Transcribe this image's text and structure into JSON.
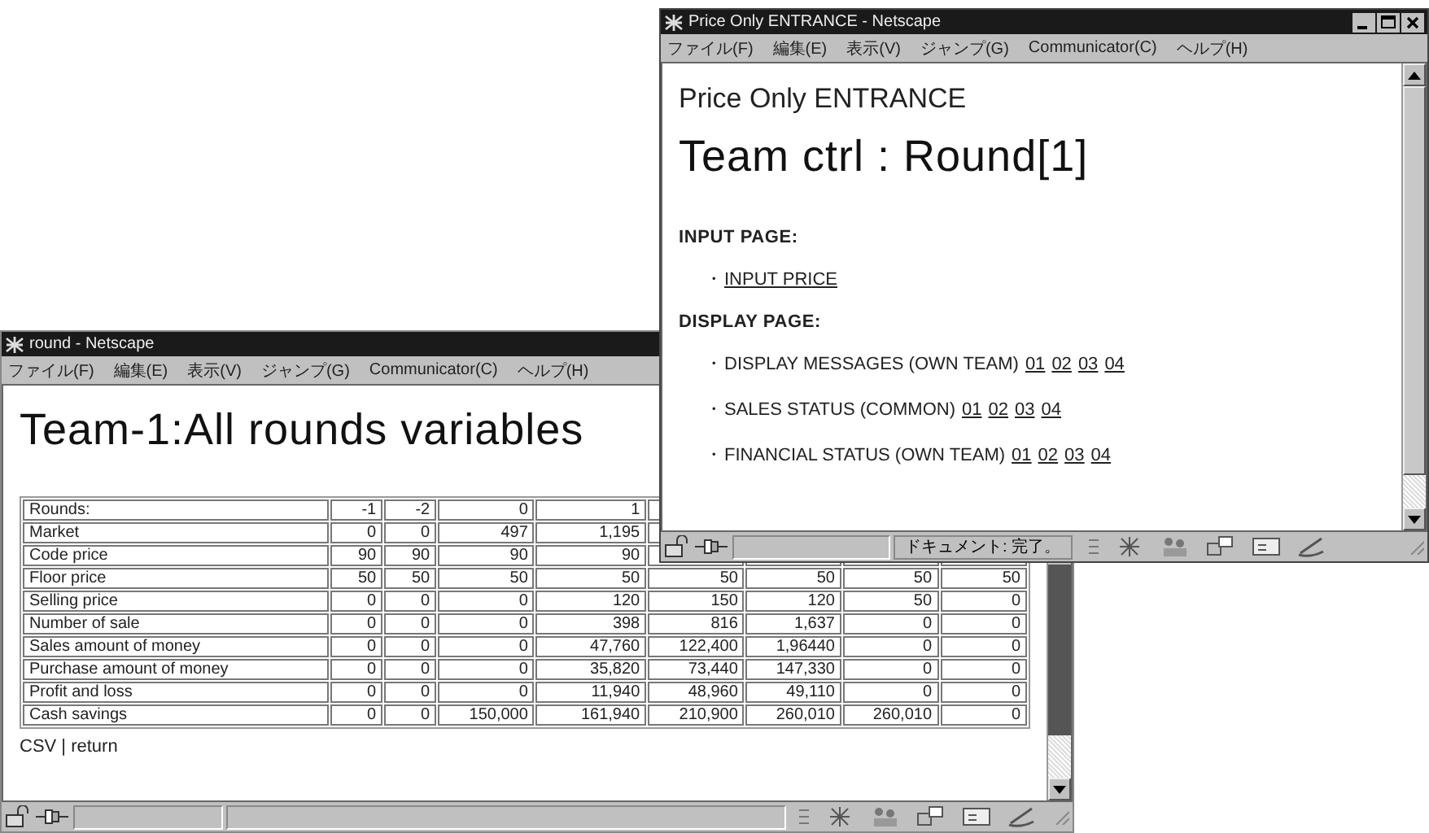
{
  "round_window": {
    "title": "round - Netscape",
    "menu": [
      "ファイル(F)",
      "編集(E)",
      "表示(V)",
      "ジャンプ(G)",
      "Communicator(C)",
      "ヘルプ(H)"
    ],
    "heading": "Team-1:All rounds variables",
    "table": {
      "columns": [
        "Rounds:",
        "-1",
        "-2",
        "0",
        "1"
      ],
      "rows": [
        {
          "label": "Market",
          "values": [
            "0",
            "0",
            "497",
            "1,195"
          ]
        },
        {
          "label": "Code price",
          "values": [
            "90",
            "90",
            "90",
            "90"
          ]
        },
        {
          "label": "Floor price",
          "values": [
            "50",
            "50",
            "50",
            "50",
            "50",
            "50",
            "50",
            "50"
          ]
        },
        {
          "label": "Selling price",
          "values": [
            "0",
            "0",
            "0",
            "120",
            "150",
            "120",
            "50",
            "0"
          ]
        },
        {
          "label": "Number of sale",
          "values": [
            "0",
            "0",
            "0",
            "398",
            "816",
            "1,637",
            "0",
            "0"
          ]
        },
        {
          "label": "Sales amount of money",
          "values": [
            "0",
            "0",
            "0",
            "47,760",
            "122,400",
            "1,96440",
            "0",
            "0"
          ]
        },
        {
          "label": "Purchase amount of money",
          "values": [
            "0",
            "0",
            "0",
            "35,820",
            "73,440",
            "147,330",
            "0",
            "0"
          ]
        },
        {
          "label": "Profit and loss",
          "values": [
            "0",
            "0",
            "0",
            "11,940",
            "48,960",
            "49,110",
            "0",
            "0"
          ]
        },
        {
          "label": "Cash savings",
          "values": [
            "0",
            "0",
            "150,000",
            "161,940",
            "210,900",
            "260,010",
            "260,010",
            "0"
          ]
        }
      ]
    },
    "footer": "CSV | return"
  },
  "entrance_window": {
    "title": "Price Only ENTRANCE - Netscape",
    "menu": [
      "ファイル(F)",
      "編集(E)",
      "表示(V)",
      "ジャンプ(G)",
      "Communicator(C)",
      "ヘルプ(H)"
    ],
    "subtitle": "Price Only ENTRANCE",
    "heading": "Team ctrl : Round[1]",
    "sections": [
      {
        "title": "INPUT PAGE:",
        "items": [
          {
            "bullet": "・",
            "label": "INPUT PRICE",
            "kind": "link"
          }
        ]
      },
      {
        "title": "DISPLAY PAGE:",
        "items": [
          {
            "bullet": "・",
            "label": "DISPLAY MESSAGES (OWN TEAM)",
            "kind": "text",
            "links": [
              "01",
              "02",
              "03",
              "04"
            ]
          },
          {
            "bullet": "・",
            "label": "SALES STATUS (COMMON)",
            "kind": "text",
            "links": [
              "01",
              "02",
              "03",
              "04"
            ]
          },
          {
            "bullet": "・",
            "label": "FINANCIAL STATUS (OWN TEAM)",
            "kind": "text",
            "links": [
              "01",
              "02",
              "03",
              "04"
            ]
          }
        ]
      }
    ],
    "status_text": "ドキュメント: 完了。"
  }
}
